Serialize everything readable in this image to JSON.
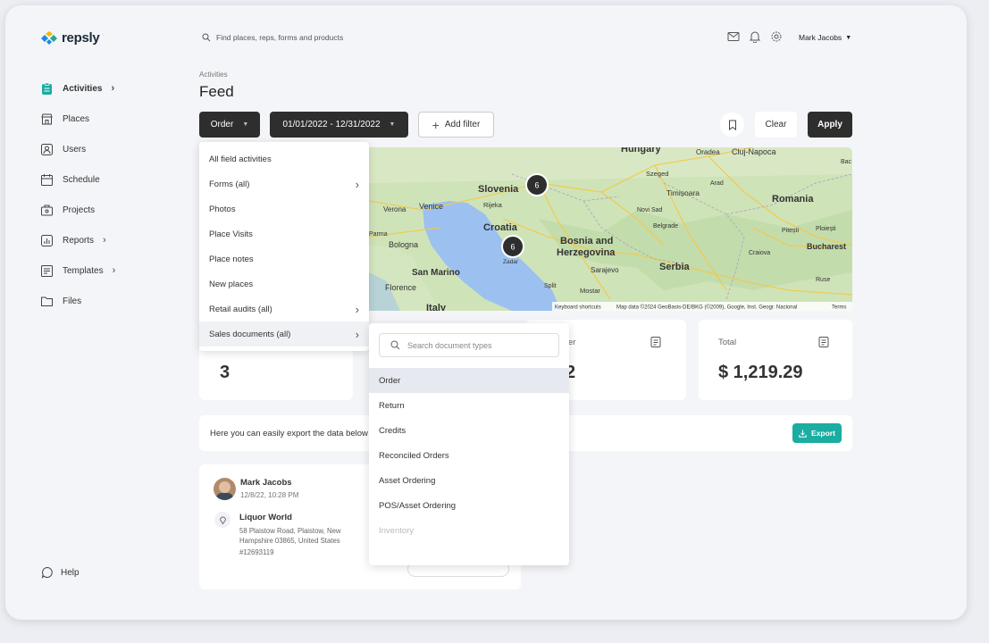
{
  "brand": {
    "name": "repsly"
  },
  "search": {
    "placeholder": "Find places, reps, forms and products"
  },
  "user": {
    "name": "Mark Jacobs"
  },
  "nav": {
    "items": [
      {
        "label": "Activities"
      },
      {
        "label": "Places"
      },
      {
        "label": "Users"
      },
      {
        "label": "Schedule"
      },
      {
        "label": "Projects"
      },
      {
        "label": "Reports"
      },
      {
        "label": "Templates"
      },
      {
        "label": "Files"
      }
    ],
    "help": "Help"
  },
  "page": {
    "breadcrumb": "Activities",
    "title": "Feed"
  },
  "filters": {
    "type": "Order",
    "date_range": "01/01/2022 - 12/31/2022",
    "add_filter": "Add filter",
    "clear": "Clear",
    "apply": "Apply"
  },
  "activity_menu": {
    "items": [
      {
        "label": "All field activities",
        "arrow": ""
      },
      {
        "label": "Forms (all)",
        "arrow": "›"
      },
      {
        "label": "Photos",
        "arrow": ""
      },
      {
        "label": "Place Visits",
        "arrow": ""
      },
      {
        "label": "Place notes",
        "arrow": ""
      },
      {
        "label": "New places",
        "arrow": ""
      },
      {
        "label": "Retail audits (all)",
        "arrow": "›"
      },
      {
        "label": "Sales documents (all)",
        "arrow": "›"
      }
    ]
  },
  "doc_menu": {
    "search_placeholder": "Search document types",
    "items": [
      "Order",
      "Return",
      "Credits",
      "Reconciled Orders",
      "Asset Ordering",
      "POS/Asset Ordering",
      "Inventory"
    ]
  },
  "map": {
    "labels": {
      "hungary": "Hungary",
      "slovenia": "Slovenia",
      "croatia": "Croatia",
      "bosnia1": "Bosnia and",
      "bosnia2": "Herzegovina",
      "serbia": "Serbia",
      "romania": "Romania",
      "bucharest": "Bucharest",
      "venice": "Venice",
      "verona": "Verona",
      "bologna": "Bologna",
      "sanmarino": "San Marino",
      "florence": "Florence",
      "italy": "Italy",
      "rijeka": "Rijeka",
      "zadar": "Zadar",
      "split": "Split",
      "sarajevo": "Sarajevo",
      "mostar": "Mostar",
      "szeged": "Szeged",
      "timisoara": "Timișoara",
      "arad": "Arad",
      "belgrade": "Belgrade",
      "oradea": "Oradea",
      "clujnapoca": "Cluj-Napoca",
      "pitesti": "Pitești",
      "ploiesti": "Ploiești",
      "craiova": "Craiova",
      "ruse": "Ruse",
      "parma": "Parma",
      "novisad": "Novi Sad",
      "bac": "Bac"
    },
    "cluster1": "6",
    "cluster2": "6",
    "footer": {
      "shortcuts": "Keyboard shortcuts",
      "attribution": "Map data ©2024 GeoBasis-DE/BKG (©2009), Google, Inst. Geogr. Nacional",
      "terms": "Terms"
    }
  },
  "stats": {
    "first": {
      "value": "3"
    },
    "second": {
      "label_fragment": "er",
      "value": "2"
    },
    "total": {
      "label": "Total",
      "value": "$ 1,219.29"
    }
  },
  "export": {
    "text": "Here you can easily export the data below",
    "button": "Export"
  },
  "activity": {
    "user": "Mark Jacobs",
    "datetime": "12/8/22, 10:28 PM",
    "place": "Liquor World",
    "address_line1": "58 Plaistow Road, Plaistow, New",
    "address_line2": "Hampshire 03865, United States",
    "id": "#12693119"
  },
  "colors": {
    "accent": "#1bada1",
    "dark": "#2e2e2e",
    "map_water": "#9cc0f0",
    "map_land": "#cfe3b8",
    "logo_blue": "#1e88e5",
    "logo_yellow": "#f5b800",
    "logo_teal": "#26a69a"
  }
}
